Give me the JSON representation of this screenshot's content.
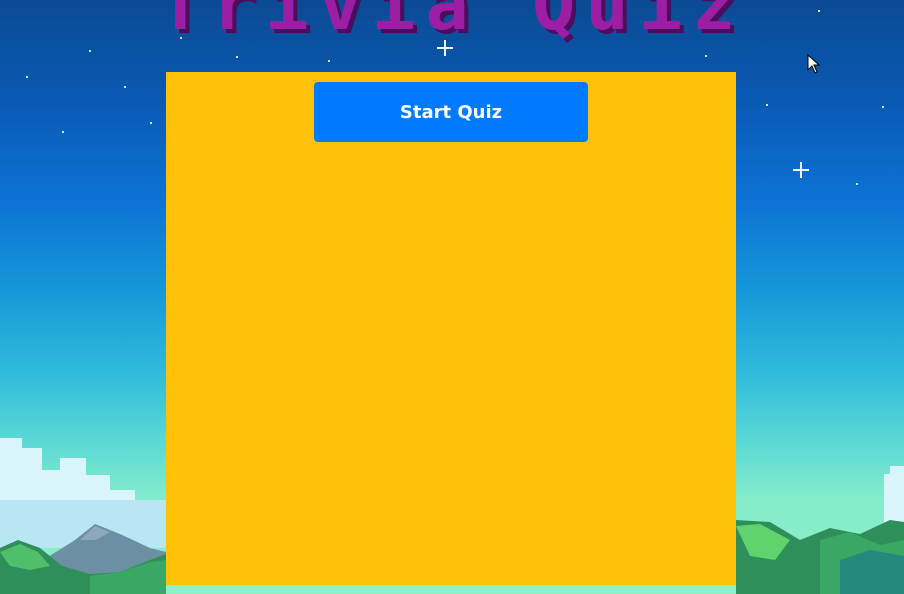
{
  "page": {
    "title": "Trivia Quiz"
  },
  "quiz": {
    "start_button_label": "Start Quiz"
  },
  "icons": {
    "cursor": "mouse-pointer-icon"
  },
  "colors": {
    "title": "#9c1ea5",
    "panel": "#ffc107",
    "button": "#007bff",
    "button_text": "#ffffff"
  }
}
